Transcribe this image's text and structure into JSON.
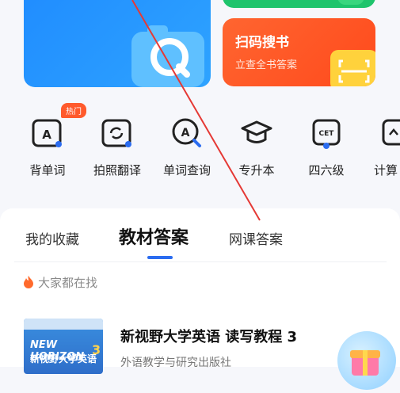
{
  "cards": {
    "blue_label": "",
    "orange_title": "扫码搜书",
    "orange_subtitle": "立查全书答案"
  },
  "tools": {
    "hot_badge": "热门",
    "items": [
      {
        "label": "背单词",
        "icon": "a-card-icon"
      },
      {
        "label": "拍照翻译",
        "icon": "photo-translate-icon"
      },
      {
        "label": "单词查询",
        "icon": "word-search-icon"
      },
      {
        "label": "专升本",
        "icon": "graduation-cap-icon"
      },
      {
        "label": "四六级",
        "icon": "cet-icon"
      },
      {
        "label": "计算",
        "icon": "calculator-icon"
      }
    ]
  },
  "tabs": {
    "items": [
      {
        "label": "我的收藏"
      },
      {
        "label": "教材答案"
      },
      {
        "label": "网课答案"
      }
    ],
    "active": "教材答案"
  },
  "trending": {
    "label": "大家都在找"
  },
  "book": {
    "cover_en": "NEW HORIZON",
    "cover_cn": "新视野大学英语",
    "cover_num": "3",
    "title": "新视野大学英语 读写教程 3",
    "publisher": "外语教学与研究出版社"
  },
  "colors": {
    "accent_blue": "#2b6cf0",
    "card_blue": "#1f8bff",
    "card_green": "#1ec46c",
    "card_orange": "#ff5a2c",
    "annotation_red": "#e53935"
  }
}
